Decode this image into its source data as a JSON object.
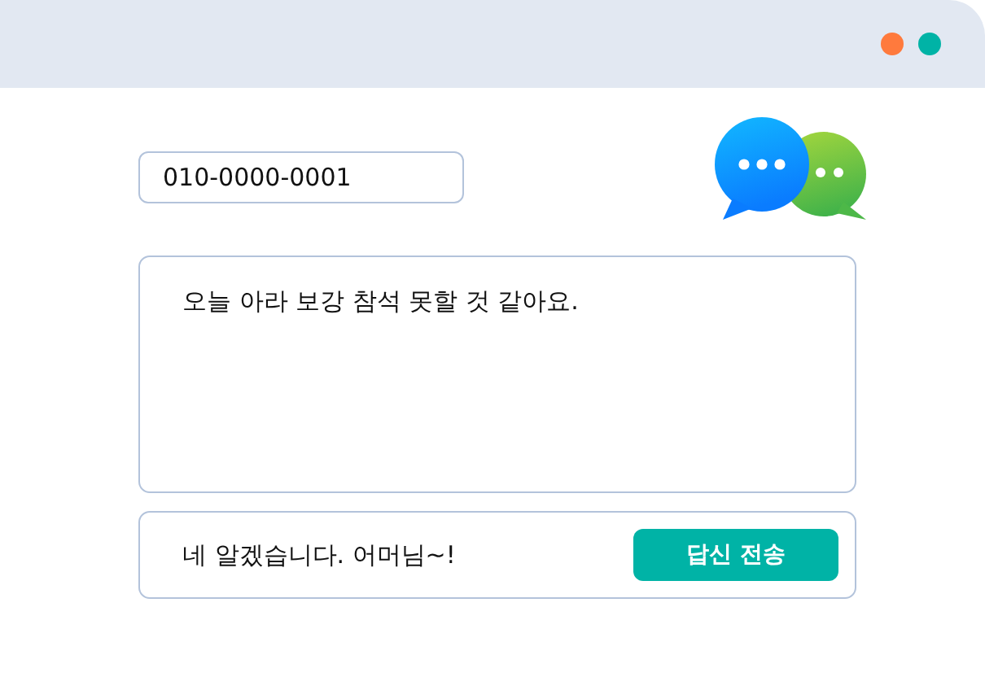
{
  "window": {
    "controls": [
      {
        "color": "#ff7a3d"
      },
      {
        "color": "#00b3a6"
      }
    ]
  },
  "phone_field": {
    "value": "010-0000-0001"
  },
  "message": {
    "text": "오늘 아라 보강 참석 못할 것 같아요."
  },
  "reply": {
    "value": "네 알겠습니다. 어머님~!",
    "button": "답신 전송"
  }
}
